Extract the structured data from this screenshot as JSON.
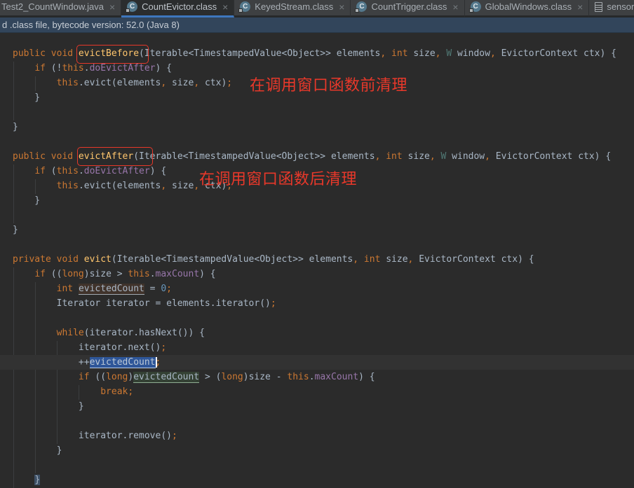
{
  "tabs": [
    {
      "label": "Test2_CountWindow.java",
      "icon": "none",
      "close": "×",
      "active": false
    },
    {
      "label": "CountEvictor.class",
      "icon": "class",
      "close": "×",
      "active": true
    },
    {
      "label": "KeyedStream.class",
      "icon": "class",
      "close": "×",
      "active": false
    },
    {
      "label": "CountTrigger.class",
      "icon": "class",
      "close": "×",
      "active": false
    },
    {
      "label": "GlobalWindows.class",
      "icon": "class",
      "close": "×",
      "active": false
    },
    {
      "label": "sensorTime",
      "icon": "file",
      "close": "",
      "active": false
    }
  ],
  "banner": {
    "text": "d .class file, bytecode version: 52.0 (Java 8)"
  },
  "colors": {
    "editor_background": "#2B2B2B",
    "tab_bar_background": "#3C3E40",
    "active_tab_underline": "#3E77BD",
    "banner_background": "#32455B",
    "keyword_orange": "#CC7832",
    "method_yellow": "#FFC66D",
    "field_purple": "#9876AA",
    "number_blue": "#6897BB",
    "default_text": "#A9B7C6",
    "annotation_red": "#E8382A",
    "selection_blue": "#2E5699"
  },
  "annotations": {
    "notes": [
      {
        "text": "在调用窗口函数前清理"
      },
      {
        "text": "在调用窗口函数后清理"
      }
    ]
  },
  "editor": {
    "lines": [
      {
        "tokens": [
          [
            "kw",
            "public void "
          ],
          [
            "fn",
            "evictBefore"
          ],
          [
            "def",
            "(Iterable<TimestampedValue<Object>> elements"
          ],
          [
            "kw",
            ","
          ],
          [
            "def",
            " "
          ],
          [
            "kw",
            "int"
          ],
          [
            "def",
            " size"
          ],
          [
            "kw",
            ","
          ],
          [
            "def",
            " "
          ],
          [
            "tp",
            "W"
          ],
          [
            "def",
            " window"
          ],
          [
            "kw",
            ","
          ],
          [
            "def",
            " EvictorContext ctx) {"
          ]
        ]
      },
      {
        "tokens": [
          [
            "def",
            "    "
          ],
          [
            "kw",
            "if"
          ],
          [
            "def",
            " (!"
          ],
          [
            "kw",
            "this"
          ],
          [
            "def",
            "."
          ],
          [
            "fld",
            "doEvictAfter"
          ],
          [
            "def",
            ") {"
          ]
        ]
      },
      {
        "tokens": [
          [
            "def",
            "        "
          ],
          [
            "kw",
            "this"
          ],
          [
            "def",
            ".evict(elements"
          ],
          [
            "kw",
            ","
          ],
          [
            "def",
            " size"
          ],
          [
            "kw",
            ","
          ],
          [
            "def",
            " ctx)"
          ],
          [
            "kw",
            ";"
          ]
        ]
      },
      {
        "tokens": [
          [
            "def",
            "    }"
          ]
        ]
      },
      {
        "tokens": []
      },
      {
        "tokens": [
          [
            "def",
            "}"
          ]
        ]
      },
      {
        "tokens": []
      },
      {
        "tokens": [
          [
            "kw",
            "public void "
          ],
          [
            "fn",
            "evictAfter"
          ],
          [
            "def",
            "(Iterable<TimestampedValue<Object>> elements"
          ],
          [
            "kw",
            ","
          ],
          [
            "def",
            " "
          ],
          [
            "kw",
            "int"
          ],
          [
            "def",
            " size"
          ],
          [
            "kw",
            ","
          ],
          [
            "def",
            " "
          ],
          [
            "tp",
            "W"
          ],
          [
            "def",
            " window"
          ],
          [
            "kw",
            ","
          ],
          [
            "def",
            " EvictorContext ctx) {"
          ]
        ]
      },
      {
        "tokens": [
          [
            "def",
            "    "
          ],
          [
            "kw",
            "if"
          ],
          [
            "def",
            " ("
          ],
          [
            "kw",
            "this"
          ],
          [
            "def",
            "."
          ],
          [
            "fld",
            "doEvictAfter"
          ],
          [
            "def",
            ") {"
          ]
        ]
      },
      {
        "tokens": [
          [
            "def",
            "        "
          ],
          [
            "kw",
            "this"
          ],
          [
            "def",
            ".evict(elements"
          ],
          [
            "kw",
            ","
          ],
          [
            "def",
            " size"
          ],
          [
            "kw",
            ","
          ],
          [
            "def",
            " ctx)"
          ],
          [
            "kw",
            ";"
          ]
        ]
      },
      {
        "tokens": [
          [
            "def",
            "    }"
          ]
        ]
      },
      {
        "tokens": []
      },
      {
        "tokens": [
          [
            "def",
            "}"
          ]
        ]
      },
      {
        "tokens": []
      },
      {
        "tokens": [
          [
            "kw",
            "private void "
          ],
          [
            "fn",
            "evict"
          ],
          [
            "def",
            "(Iterable<TimestampedValue<Object>> elements"
          ],
          [
            "kw",
            ","
          ],
          [
            "def",
            " "
          ],
          [
            "kw",
            "int"
          ],
          [
            "def",
            " size"
          ],
          [
            "kw",
            ","
          ],
          [
            "def",
            " EvictorContext ctx) {"
          ]
        ]
      },
      {
        "tokens": [
          [
            "def",
            "    "
          ],
          [
            "kw",
            "if"
          ],
          [
            "def",
            " (("
          ],
          [
            "kw",
            "long"
          ],
          [
            "def",
            ")size > "
          ],
          [
            "kw",
            "this"
          ],
          [
            "def",
            "."
          ],
          [
            "fld",
            "maxCount"
          ],
          [
            "def",
            ") {"
          ]
        ]
      },
      {
        "tokens": [
          [
            "def",
            "        "
          ],
          [
            "kw",
            "int"
          ],
          [
            "def",
            " "
          ],
          [
            "hlw",
            "evictedCount"
          ],
          [
            "def",
            " = "
          ],
          [
            "num",
            "0"
          ],
          [
            "kw",
            ";"
          ]
        ]
      },
      {
        "tokens": [
          [
            "def",
            "        Iterator iterator = elements.iterator()"
          ],
          [
            "kw",
            ";"
          ]
        ]
      },
      {
        "tokens": []
      },
      {
        "tokens": [
          [
            "def",
            "        "
          ],
          [
            "kw",
            "while"
          ],
          [
            "def",
            "(iterator.hasNext()) {"
          ]
        ]
      },
      {
        "tokens": [
          [
            "def",
            "            iterator.next()"
          ],
          [
            "kw",
            ";"
          ]
        ]
      },
      {
        "current": true,
        "tokens": [
          [
            "def",
            "            ++"
          ],
          [
            "hls",
            "evictedCount"
          ],
          [
            "caret",
            ""
          ],
          [
            "kw",
            ";"
          ]
        ]
      },
      {
        "tokens": [
          [
            "def",
            "            "
          ],
          [
            "kw",
            "if"
          ],
          [
            "def",
            " (("
          ],
          [
            "kw",
            "long"
          ],
          [
            "def",
            ")"
          ],
          [
            "hlr",
            "evictedCount"
          ],
          [
            "def",
            " > ("
          ],
          [
            "kw",
            "long"
          ],
          [
            "def",
            ")size - "
          ],
          [
            "kw",
            "this"
          ],
          [
            "def",
            "."
          ],
          [
            "fld",
            "maxCount"
          ],
          [
            "def",
            ") {"
          ]
        ]
      },
      {
        "tokens": [
          [
            "def",
            "                "
          ],
          [
            "kw",
            "break;"
          ]
        ]
      },
      {
        "tokens": [
          [
            "def",
            "            }"
          ]
        ]
      },
      {
        "tokens": []
      },
      {
        "tokens": [
          [
            "def",
            "            iterator.remove()"
          ],
          [
            "kw",
            ";"
          ]
        ]
      },
      {
        "tokens": [
          [
            "def",
            "        }"
          ]
        ]
      },
      {
        "tokens": []
      },
      {
        "tokens": [
          [
            "def",
            "    "
          ],
          [
            "brc",
            "}"
          ]
        ]
      }
    ]
  }
}
